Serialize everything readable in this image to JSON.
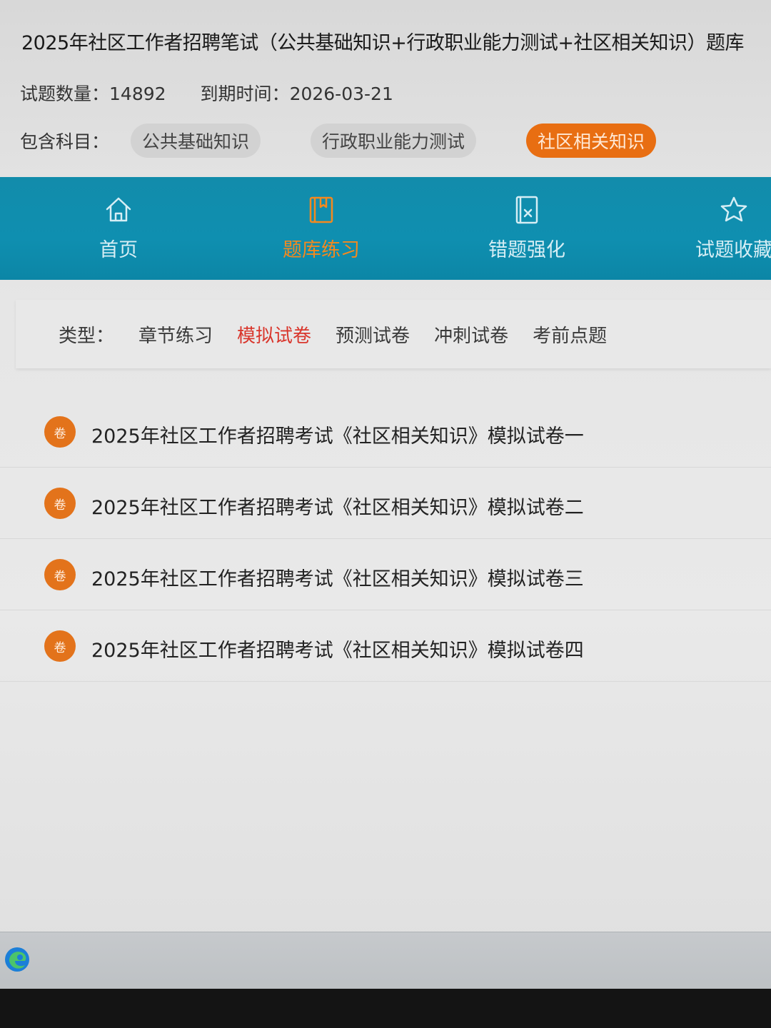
{
  "header": {
    "title": "2025年社区工作者招聘笔试（公共基础知识+行政职业能力测试+社区相关知识）题库",
    "question_count_label": "试题数量：",
    "question_count": "14892",
    "expiry_label": "到期时间：",
    "expiry_date": "2026-03-21",
    "subjects_label": "包含科目：",
    "subjects": [
      {
        "label": "公共基础知识",
        "active": false
      },
      {
        "label": "行政职业能力测试",
        "active": false
      },
      {
        "label": "社区相关知识",
        "active": true
      }
    ]
  },
  "nav": {
    "items": [
      {
        "label": "首页",
        "icon": "home-icon",
        "active": false
      },
      {
        "label": "题库练习",
        "icon": "book-icon",
        "active": true
      },
      {
        "label": "错题强化",
        "icon": "wrong-question-icon",
        "active": false
      },
      {
        "label": "试题收藏",
        "icon": "star-icon",
        "active": false
      }
    ]
  },
  "types": {
    "label": "类型：",
    "options": [
      {
        "label": "章节练习",
        "active": false
      },
      {
        "label": "模拟试卷",
        "active": true
      },
      {
        "label": "预测试卷",
        "active": false
      },
      {
        "label": "冲刺试卷",
        "active": false
      },
      {
        "label": "考前点题",
        "active": false
      }
    ]
  },
  "papers": {
    "badge": "卷",
    "items": [
      "2025年社区工作者招聘考试《社区相关知识》模拟试卷一",
      "2025年社区工作者招聘考试《社区相关知识》模拟试卷二",
      "2025年社区工作者招聘考试《社区相关知识》模拟试卷三",
      "2025年社区工作者招聘考试《社区相关知识》模拟试卷四"
    ]
  },
  "taskbar": {
    "apps": [
      {
        "icon": "edge-browser-icon"
      }
    ]
  },
  "colors": {
    "nav_bg": "#128cab",
    "accent_orange": "#e86e12",
    "active_type_red": "#d9362c"
  }
}
